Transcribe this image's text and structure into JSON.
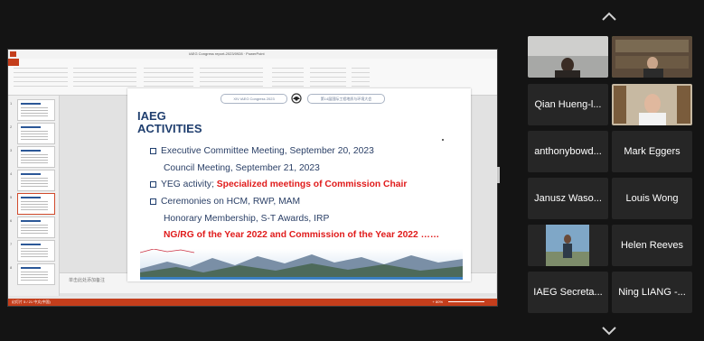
{
  "ppt": {
    "window_title": "IAEG Congress report-2023/0928 · PowerPoint",
    "notes_placeholder": "单击此处添加备注",
    "status_left": "幻灯片 5 / 21  中文(中国)",
    "zoom_label": "+ 80%"
  },
  "slide": {
    "banner_left": "XIV IAEG Congress 2023",
    "banner_right": "第14届国际工程地质与环境大会",
    "title_line1": "IAEG",
    "title_line2": "ACTIVITIES",
    "line1": "Executive Committee Meeting, September 20, 2023",
    "line2": "Council Meeting, September 21, 2023",
    "line3_prefix": "YEG activity; ",
    "line3_highlight": "Specialized meetings of Commission Chair",
    "line4": "Ceremonies on HCM, RWP, MAM",
    "line5": "Honorary Membership, S-T Awards, IRP",
    "line6": "NG/RG of the Year 2022 and Commission of the Year 2022 ……",
    "highlight_color": "#e01b1b"
  },
  "participants": [
    {
      "name": "",
      "video": true
    },
    {
      "name": "",
      "video": true,
      "active_speaker": true
    },
    {
      "name": "Qian Hueng-l...",
      "video": false
    },
    {
      "name": "",
      "video": true
    },
    {
      "name": "anthonybowd...",
      "video": false
    },
    {
      "name": "Mark Eggers",
      "video": false
    },
    {
      "name": "Janusz Waso...",
      "video": false
    },
    {
      "name": "Louis Wong",
      "video": false
    },
    {
      "name": "",
      "video": true
    },
    {
      "name": "Helen Reeves",
      "video": false
    },
    {
      "name": "IAEG Secreta...",
      "video": false
    },
    {
      "name": "Ning LIANG -...",
      "video": false
    }
  ],
  "nav": {
    "up_icon": "chevron-up-icon",
    "down_icon": "chevron-down-icon"
  },
  "colors": {
    "background": "#141414",
    "tile": "#262626",
    "active_border": "#4a9a3c"
  }
}
